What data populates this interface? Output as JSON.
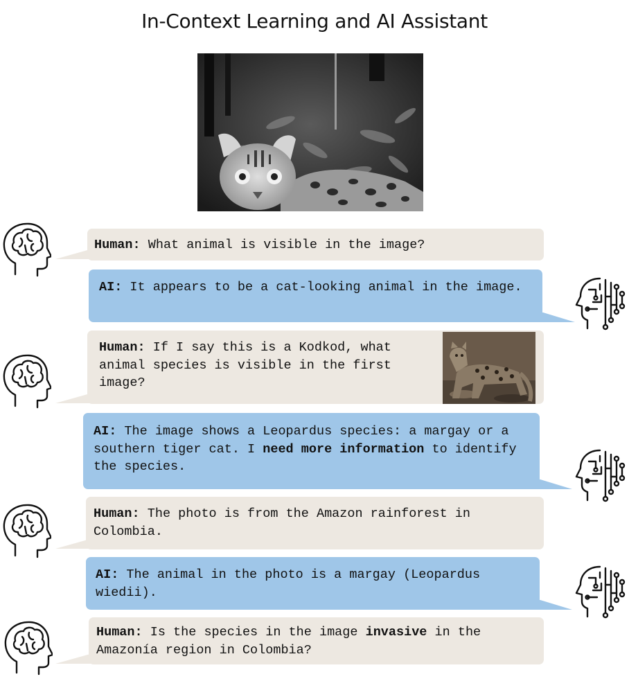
{
  "title": "In-Context Learning and AI Assistant",
  "messages": [
    {
      "speaker": "Human:",
      "text": "What animal is visible in the image?"
    },
    {
      "speaker": "AI:",
      "text": "It appears to be a cat-looking animal in the image."
    },
    {
      "speaker": "Human:",
      "text": "If I say this is a Kodkod, what animal species is visible in the first image?"
    },
    {
      "speaker": "AI:",
      "text_before": "The image shows a Leopardus species: a margay or a southern tiger cat. I",
      "bold": "need more information",
      "text_after": "to identify the species."
    },
    {
      "speaker": "Human:",
      "text": "The photo is from the Amazon rainforest in Colombia."
    },
    {
      "speaker": "AI:",
      "text": "The animal in the photo is a margay (Leopardus wiedii)."
    },
    {
      "speaker": "Human:",
      "text_before": "Is the species in the image",
      "bold": "invasive",
      "text_after": "in the Amazonía region in Colombia?"
    }
  ],
  "icons": {
    "human": "human-brain-head-icon",
    "ai": "ai-circuit-head-icon"
  },
  "colors": {
    "human_bubble": "#ede8e1",
    "ai_bubble": "#9fc6e8"
  }
}
